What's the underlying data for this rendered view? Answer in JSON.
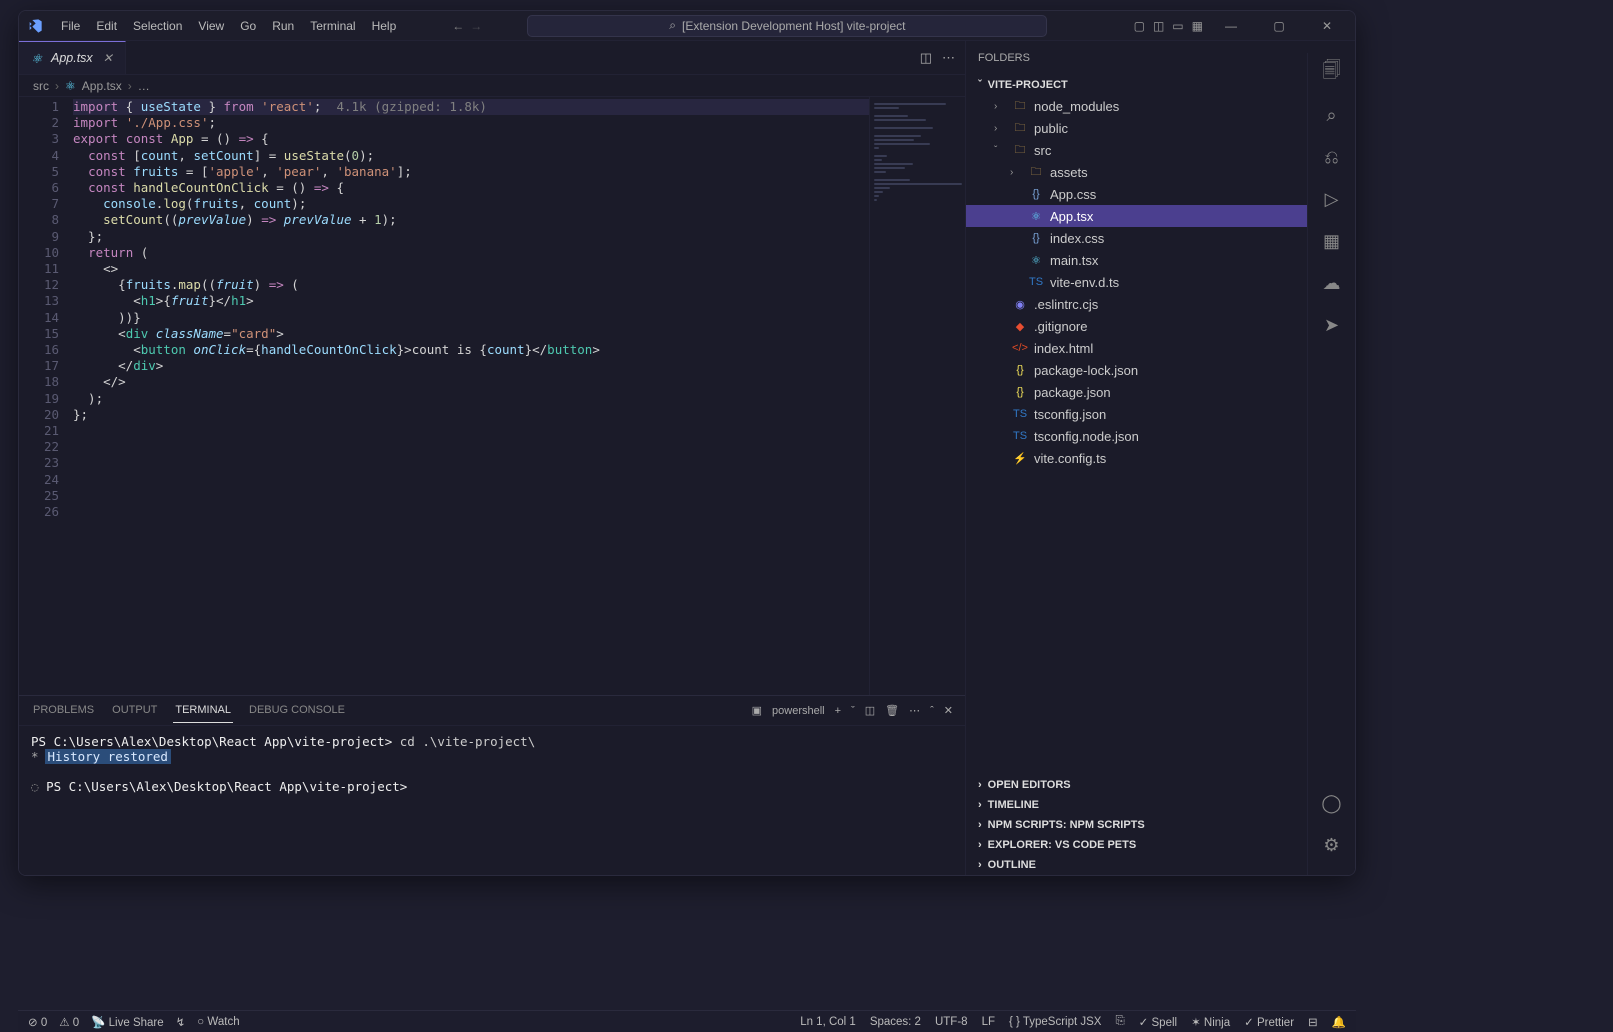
{
  "titlebar": {
    "menus": [
      "File",
      "Edit",
      "Selection",
      "View",
      "Go",
      "Run",
      "Terminal",
      "Help"
    ],
    "search_label": "[Extension Development Host] vite-project"
  },
  "tabs": [
    {
      "label": "App.tsx",
      "active": true,
      "icon": "react"
    }
  ],
  "breadcrumbs": [
    "src",
    "App.tsx",
    "…"
  ],
  "code_hint": "4.1k (gzipped: 1.8k)",
  "code_lines": [
    [
      [
        "k",
        "import"
      ],
      [
        "p",
        " { "
      ],
      [
        "v",
        "useState"
      ],
      [
        "p",
        " } "
      ],
      [
        "k",
        "from"
      ],
      [
        "p",
        " "
      ],
      [
        "s",
        "'react'"
      ],
      [
        "p",
        ";  "
      ],
      [
        "hl",
        "4.1k (gzipped: 1.8k)"
      ]
    ],
    [
      [
        "k",
        "import"
      ],
      [
        "p",
        " "
      ],
      [
        "s",
        "'./App.css'"
      ],
      [
        "p",
        ";"
      ]
    ],
    [
      [
        "p",
        ""
      ]
    ],
    [
      [
        "k",
        "export"
      ],
      [
        "p",
        " "
      ],
      [
        "k",
        "const"
      ],
      [
        "p",
        " "
      ],
      [
        "f",
        "App"
      ],
      [
        "p",
        " = () "
      ],
      [
        "k",
        "=>"
      ],
      [
        "p",
        " {"
      ]
    ],
    [
      [
        "p",
        "  "
      ],
      [
        "k",
        "const"
      ],
      [
        "p",
        " ["
      ],
      [
        "v",
        "count"
      ],
      [
        "p",
        ", "
      ],
      [
        "v",
        "setCount"
      ],
      [
        "p",
        "] = "
      ],
      [
        "f",
        "useState"
      ],
      [
        "p",
        "("
      ],
      [
        "n",
        "0"
      ],
      [
        "p",
        ");"
      ]
    ],
    [
      [
        "p",
        ""
      ]
    ],
    [
      [
        "p",
        "  "
      ],
      [
        "k",
        "const"
      ],
      [
        "p",
        " "
      ],
      [
        "v",
        "fruits"
      ],
      [
        "p",
        " = ["
      ],
      [
        "s",
        "'apple'"
      ],
      [
        "p",
        ", "
      ],
      [
        "s",
        "'pear'"
      ],
      [
        "p",
        ", "
      ],
      [
        "s",
        "'banana'"
      ],
      [
        "p",
        "];"
      ]
    ],
    [
      [
        "p",
        ""
      ]
    ],
    [
      [
        "p",
        "  "
      ],
      [
        "k",
        "const"
      ],
      [
        "p",
        " "
      ],
      [
        "f",
        "handleCountOnClick"
      ],
      [
        "p",
        " = () "
      ],
      [
        "k",
        "=>"
      ],
      [
        "p",
        " {"
      ]
    ],
    [
      [
        "p",
        "    "
      ],
      [
        "v",
        "console"
      ],
      [
        "p",
        "."
      ],
      [
        "f",
        "log"
      ],
      [
        "p",
        "("
      ],
      [
        "v",
        "fruits"
      ],
      [
        "p",
        ", "
      ],
      [
        "v",
        "count"
      ],
      [
        "p",
        ");"
      ]
    ],
    [
      [
        "p",
        "    "
      ],
      [
        "f",
        "setCount"
      ],
      [
        "p",
        "(("
      ],
      [
        "i",
        "prevValue"
      ],
      [
        "p",
        ") "
      ],
      [
        "k",
        "=>"
      ],
      [
        "p",
        " "
      ],
      [
        "i",
        "prevValue"
      ],
      [
        "p",
        " + "
      ],
      [
        "n",
        "1"
      ],
      [
        "p",
        ");"
      ]
    ],
    [
      [
        "p",
        "  };"
      ]
    ],
    [
      [
        "p",
        ""
      ]
    ],
    [
      [
        "p",
        "  "
      ],
      [
        "k",
        "return"
      ],
      [
        "p",
        " ("
      ]
    ],
    [
      [
        "p",
        "    <>"
      ]
    ],
    [
      [
        "p",
        "      {"
      ],
      [
        "v",
        "fruits"
      ],
      [
        "p",
        "."
      ],
      [
        "f",
        "map"
      ],
      [
        "p",
        "(("
      ],
      [
        "i",
        "fruit"
      ],
      [
        "p",
        ") "
      ],
      [
        "k",
        "=>"
      ],
      [
        "p",
        " ("
      ]
    ],
    [
      [
        "p",
        "        <"
      ],
      [
        "t",
        "h1"
      ],
      [
        "p",
        ">{"
      ],
      [
        "i",
        "fruit"
      ],
      [
        "p",
        "}</"
      ],
      [
        "t",
        "h1"
      ],
      [
        "p",
        ">"
      ]
    ],
    [
      [
        "p",
        "      ))}"
      ]
    ],
    [
      [
        "p",
        ""
      ]
    ],
    [
      [
        "p",
        "      <"
      ],
      [
        "t",
        "div"
      ],
      [
        "p",
        " "
      ],
      [
        "i",
        "className"
      ],
      [
        "p",
        "="
      ],
      [
        "s",
        "\"card\""
      ],
      [
        "p",
        ">"
      ]
    ],
    [
      [
        "p",
        "        <"
      ],
      [
        "t",
        "button"
      ],
      [
        "p",
        " "
      ],
      [
        "i",
        "onClick"
      ],
      [
        "p",
        "={"
      ],
      [
        "v",
        "handleCountOnClick"
      ],
      [
        "p",
        "}>count is {"
      ],
      [
        "v",
        "count"
      ],
      [
        "p",
        "}</"
      ],
      [
        "t",
        "button"
      ],
      [
        "p",
        ">"
      ]
    ],
    [
      [
        "p",
        "      </"
      ],
      [
        "t",
        "div"
      ],
      [
        "p",
        ">"
      ]
    ],
    [
      [
        "p",
        "    </>"
      ]
    ],
    [
      [
        "p",
        "  );"
      ]
    ],
    [
      [
        "p",
        "};"
      ]
    ],
    [
      [
        "p",
        ""
      ]
    ]
  ],
  "panel": {
    "tabs": [
      "PROBLEMS",
      "OUTPUT",
      "TERMINAL",
      "DEBUG CONSOLE"
    ],
    "active_tab": "TERMINAL",
    "shell_label": "powershell",
    "lines": [
      {
        "prompt": "PS C:\\Users\\Alex\\Desktop\\React App\\vite-project>",
        "cmd": " cd .\\vite-project\\"
      },
      {
        "star": "*",
        "hist": "History restored"
      },
      {
        "blank": true
      },
      {
        "prompt": "PS C:\\Users\\Alex\\Desktop\\React App\\vite-project>",
        "cmd": "",
        "ring": true
      }
    ]
  },
  "sidebar": {
    "header": "FOLDERS",
    "project": "VITE-PROJECT",
    "tree": [
      {
        "depth": 1,
        "kind": "folder",
        "open": false,
        "icon": "folder",
        "label": "node_modules"
      },
      {
        "depth": 1,
        "kind": "folder",
        "open": false,
        "icon": "folder",
        "label": "public"
      },
      {
        "depth": 1,
        "kind": "folder",
        "open": true,
        "icon": "folder",
        "label": "src"
      },
      {
        "depth": 2,
        "kind": "folder",
        "open": false,
        "icon": "folder",
        "label": "assets"
      },
      {
        "depth": 2,
        "kind": "file",
        "icon": "css",
        "label": "App.css"
      },
      {
        "depth": 2,
        "kind": "file",
        "icon": "react",
        "label": "App.tsx",
        "selected": true
      },
      {
        "depth": 2,
        "kind": "file",
        "icon": "css",
        "label": "index.css"
      },
      {
        "depth": 2,
        "kind": "file",
        "icon": "react",
        "label": "main.tsx"
      },
      {
        "depth": 2,
        "kind": "file",
        "icon": "ts",
        "label": "vite-env.d.ts"
      },
      {
        "depth": 1,
        "kind": "file",
        "icon": "eslint",
        "label": ".eslintrc.cjs"
      },
      {
        "depth": 1,
        "kind": "file",
        "icon": "git",
        "label": ".gitignore"
      },
      {
        "depth": 1,
        "kind": "file",
        "icon": "html",
        "label": "index.html"
      },
      {
        "depth": 1,
        "kind": "file",
        "icon": "json",
        "label": "package-lock.json"
      },
      {
        "depth": 1,
        "kind": "file",
        "icon": "json",
        "label": "package.json"
      },
      {
        "depth": 1,
        "kind": "file",
        "icon": "ts",
        "label": "tsconfig.json"
      },
      {
        "depth": 1,
        "kind": "file",
        "icon": "ts",
        "label": "tsconfig.node.json"
      },
      {
        "depth": 1,
        "kind": "file",
        "icon": "vite",
        "label": "vite.config.ts"
      }
    ],
    "collapsed_sections": [
      "OPEN EDITORS",
      "TIMELINE",
      "NPM SCRIPTS: NPM SCRIPTS",
      "EXPLORER: VS CODE PETS",
      "OUTLINE"
    ]
  },
  "statusbar": {
    "left": [
      {
        "icon": "⊘",
        "text": "0"
      },
      {
        "icon": "⚠",
        "text": "0"
      },
      {
        "icon": "📡",
        "text": "Live Share"
      },
      {
        "icon": "↯",
        "text": ""
      },
      {
        "icon": "○",
        "text": "Watch"
      }
    ],
    "right": [
      {
        "text": "Ln 1, Col 1"
      },
      {
        "text": "Spaces: 2"
      },
      {
        "text": "UTF-8"
      },
      {
        "text": "LF"
      },
      {
        "text": "{ } TypeScript JSX"
      },
      {
        "icon": "⎘",
        "text": ""
      },
      {
        "icon": "✓",
        "text": "Spell"
      },
      {
        "icon": "✶",
        "text": "Ninja"
      },
      {
        "icon": "✓",
        "text": "Prettier"
      },
      {
        "icon": "⊟",
        "text": ""
      },
      {
        "icon": "🔔",
        "text": ""
      }
    ]
  }
}
